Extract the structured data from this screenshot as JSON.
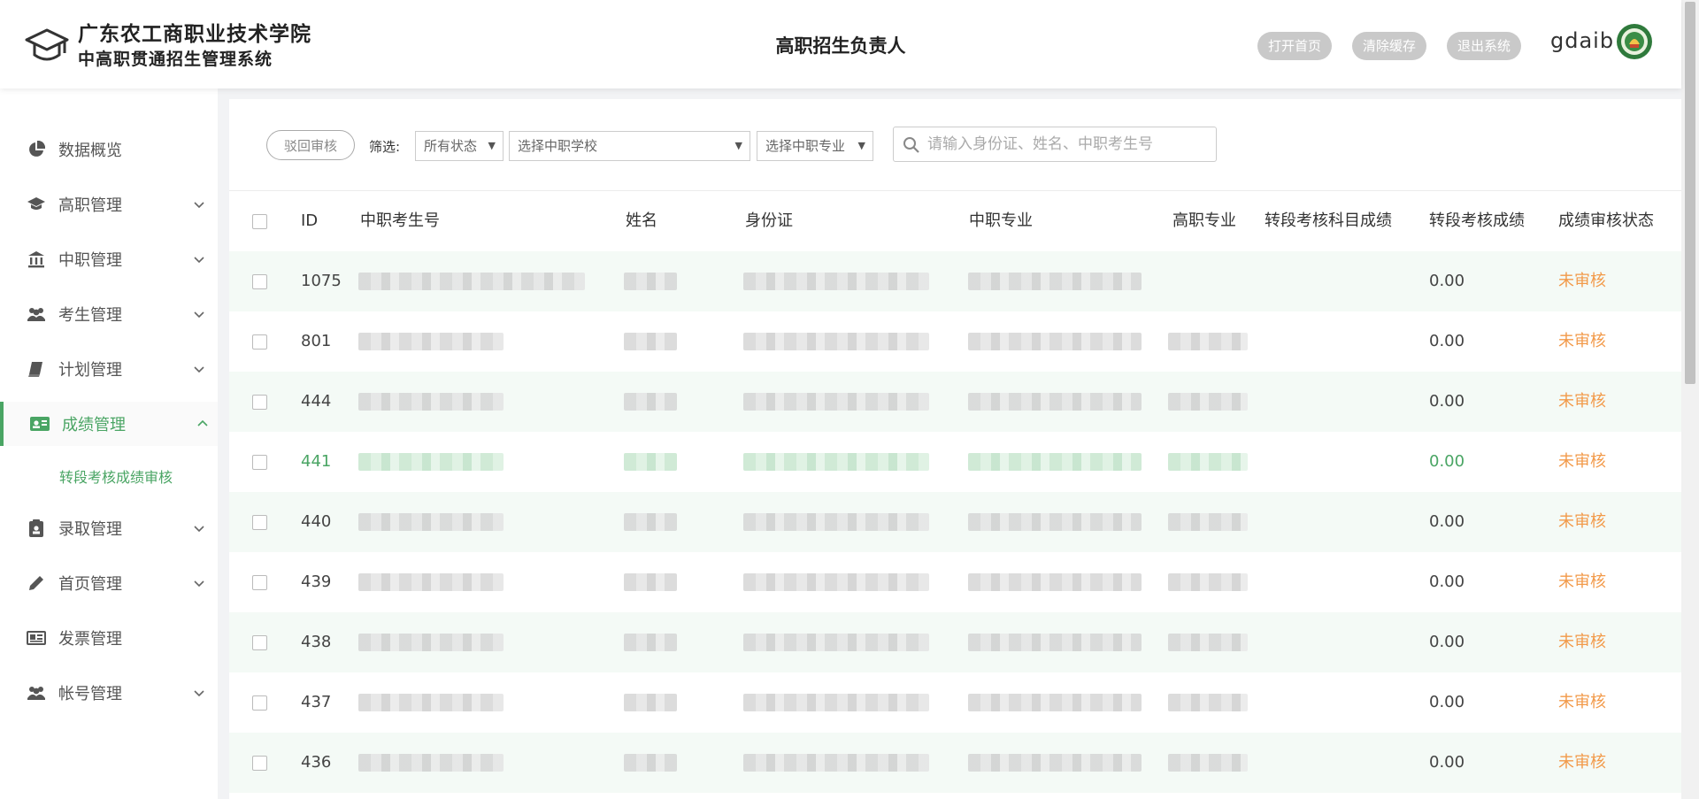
{
  "header": {
    "school_name": "广东农工商职业技术学院",
    "system_name": "中高职贯通招生管理系统",
    "role_title": "高职招生负责人",
    "buttons": [
      "打开首页",
      "清除缓存",
      "退出系统"
    ],
    "username": "gdaib"
  },
  "sidebar": {
    "items": [
      {
        "label": "数据概览",
        "icon": "pie-chart-icon",
        "expandable": false
      },
      {
        "label": "高职管理",
        "icon": "graduation-cap-icon",
        "expandable": true
      },
      {
        "label": "中职管理",
        "icon": "institution-icon",
        "expandable": true
      },
      {
        "label": "考生管理",
        "icon": "users-icon",
        "expandable": true
      },
      {
        "label": "计划管理",
        "icon": "book-icon",
        "expandable": true
      },
      {
        "label": "成绩管理",
        "icon": "id-card-icon",
        "expandable": true,
        "active": true
      },
      {
        "label": "录取管理",
        "icon": "clipboard-icon",
        "expandable": true
      },
      {
        "label": "首页管理",
        "icon": "pencil-icon",
        "expandable": true
      },
      {
        "label": "发票管理",
        "icon": "invoice-icon",
        "expandable": false
      },
      {
        "label": "帐号管理",
        "icon": "users-icon",
        "expandable": true
      }
    ],
    "sub_item": "转段考核成绩审核"
  },
  "filters": {
    "reject_button": "驳回审核",
    "label": "筛选:",
    "status_select": "所有状态",
    "school_select": "选择中职学校",
    "major_select": "选择中职专业",
    "search_placeholder": "请输入身份证、姓名、中职考生号"
  },
  "table": {
    "columns": [
      "ID",
      "中职考生号",
      "姓名",
      "身份证",
      "中职专业",
      "高职专业",
      "转段考核科目成绩",
      "转段考核成绩",
      "成绩审核状态"
    ],
    "rows": [
      {
        "id": "1075",
        "score": "0.00",
        "status": "未审核"
      },
      {
        "id": "801",
        "score": "0.00",
        "status": "未审核"
      },
      {
        "id": "444",
        "score": "0.00",
        "status": "未审核"
      },
      {
        "id": "441",
        "score": "0.00",
        "status": "未审核"
      },
      {
        "id": "440",
        "score": "0.00",
        "status": "未审核"
      },
      {
        "id": "439",
        "score": "0.00",
        "status": "未审核"
      },
      {
        "id": "438",
        "score": "0.00",
        "status": "未审核"
      },
      {
        "id": "437",
        "score": "0.00",
        "status": "未审核"
      },
      {
        "id": "436",
        "score": "0.00",
        "status": "未审核"
      }
    ]
  },
  "colors": {
    "accent": "#4aa564",
    "pending": "#f29a4a",
    "stripe": "#f4faf6"
  }
}
